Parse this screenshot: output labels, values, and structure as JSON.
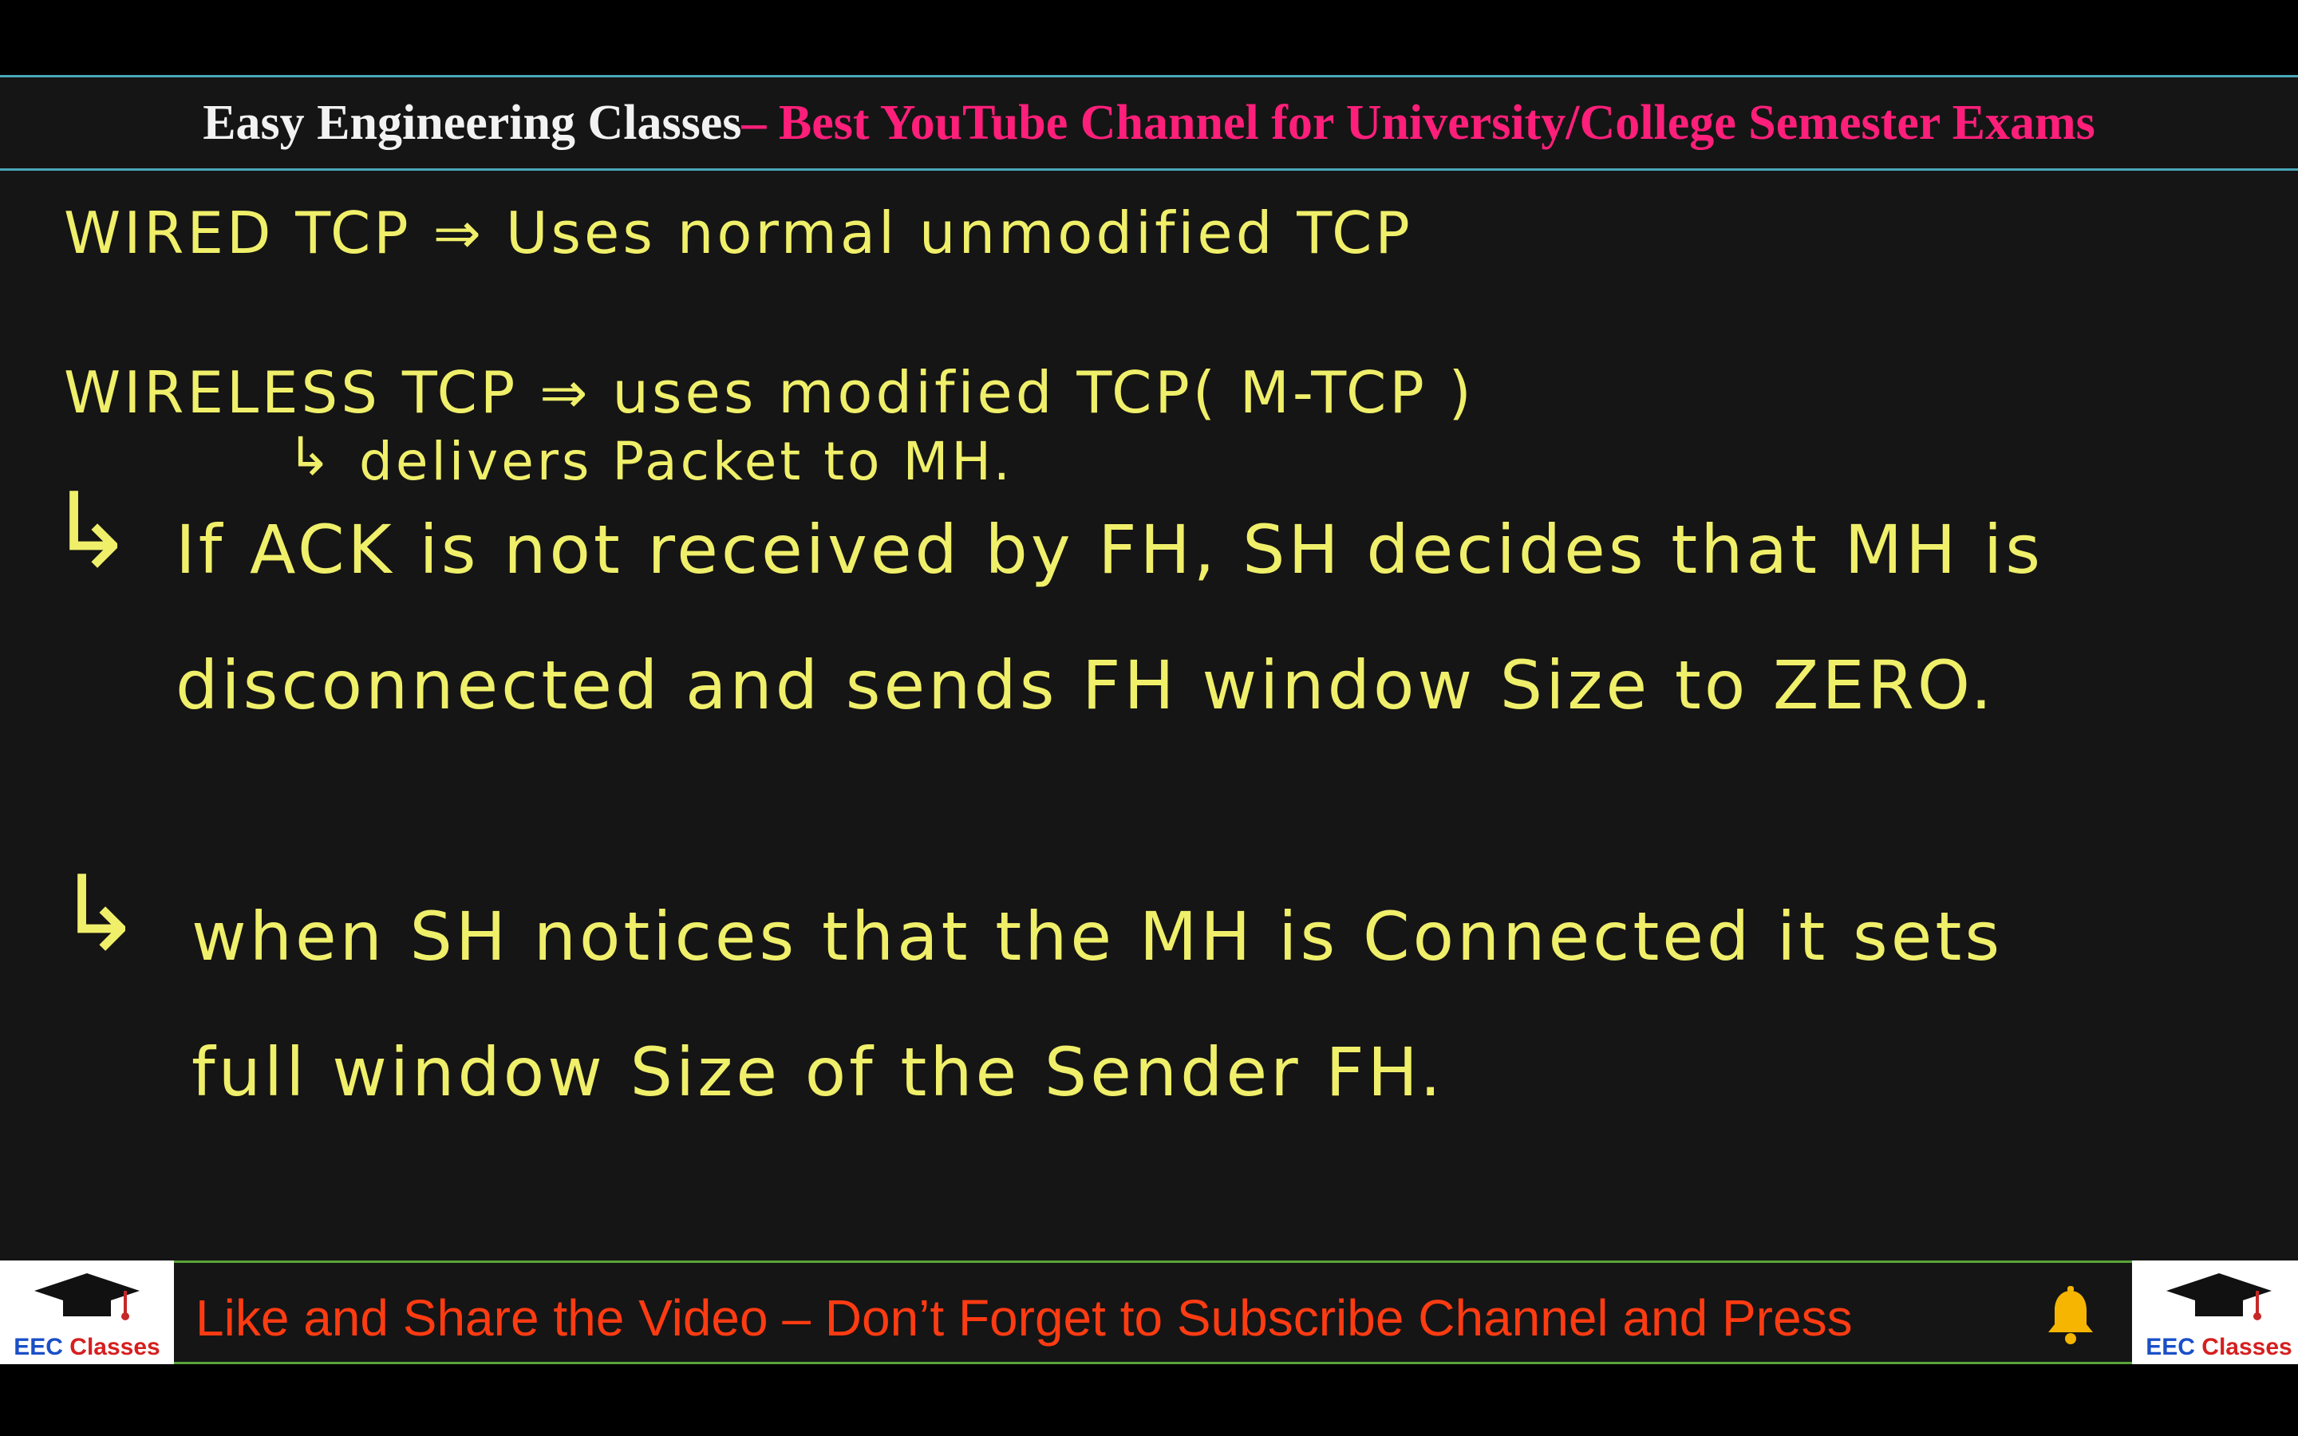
{
  "header": {
    "title_main": "Easy Engineering Classes",
    "title_sub": " – Best YouTube Channel for University/College Semester Exams"
  },
  "board": {
    "line_wired": "WIRED TCP ⇒ Uses normal unmodified TCP",
    "line_wireless": "WIRELESS TCP ⇒ uses modified TCP( M-TCP )",
    "line_delivers": "delivers Packet to MH.",
    "point1_line1": "If ACK is not received by FH, SH decides that MH is",
    "point1_line2": "disconnected and sends FH window Size to ZERO.",
    "point2_line1": "when SH notices that the MH is Connected it sets",
    "point2_line2": "full window Size of the Sender FH."
  },
  "footer": {
    "text": "Like and Share the Video – Don’t Forget to Subscribe Channel and Press",
    "logo_label_blue": "EEC",
    "logo_label_red": " Classes",
    "bell_icon": "bell-icon"
  },
  "colors": {
    "chalk": "#f0ef6a",
    "title_sub": "#ff1f7a",
    "footer_text": "#ff3b12"
  }
}
